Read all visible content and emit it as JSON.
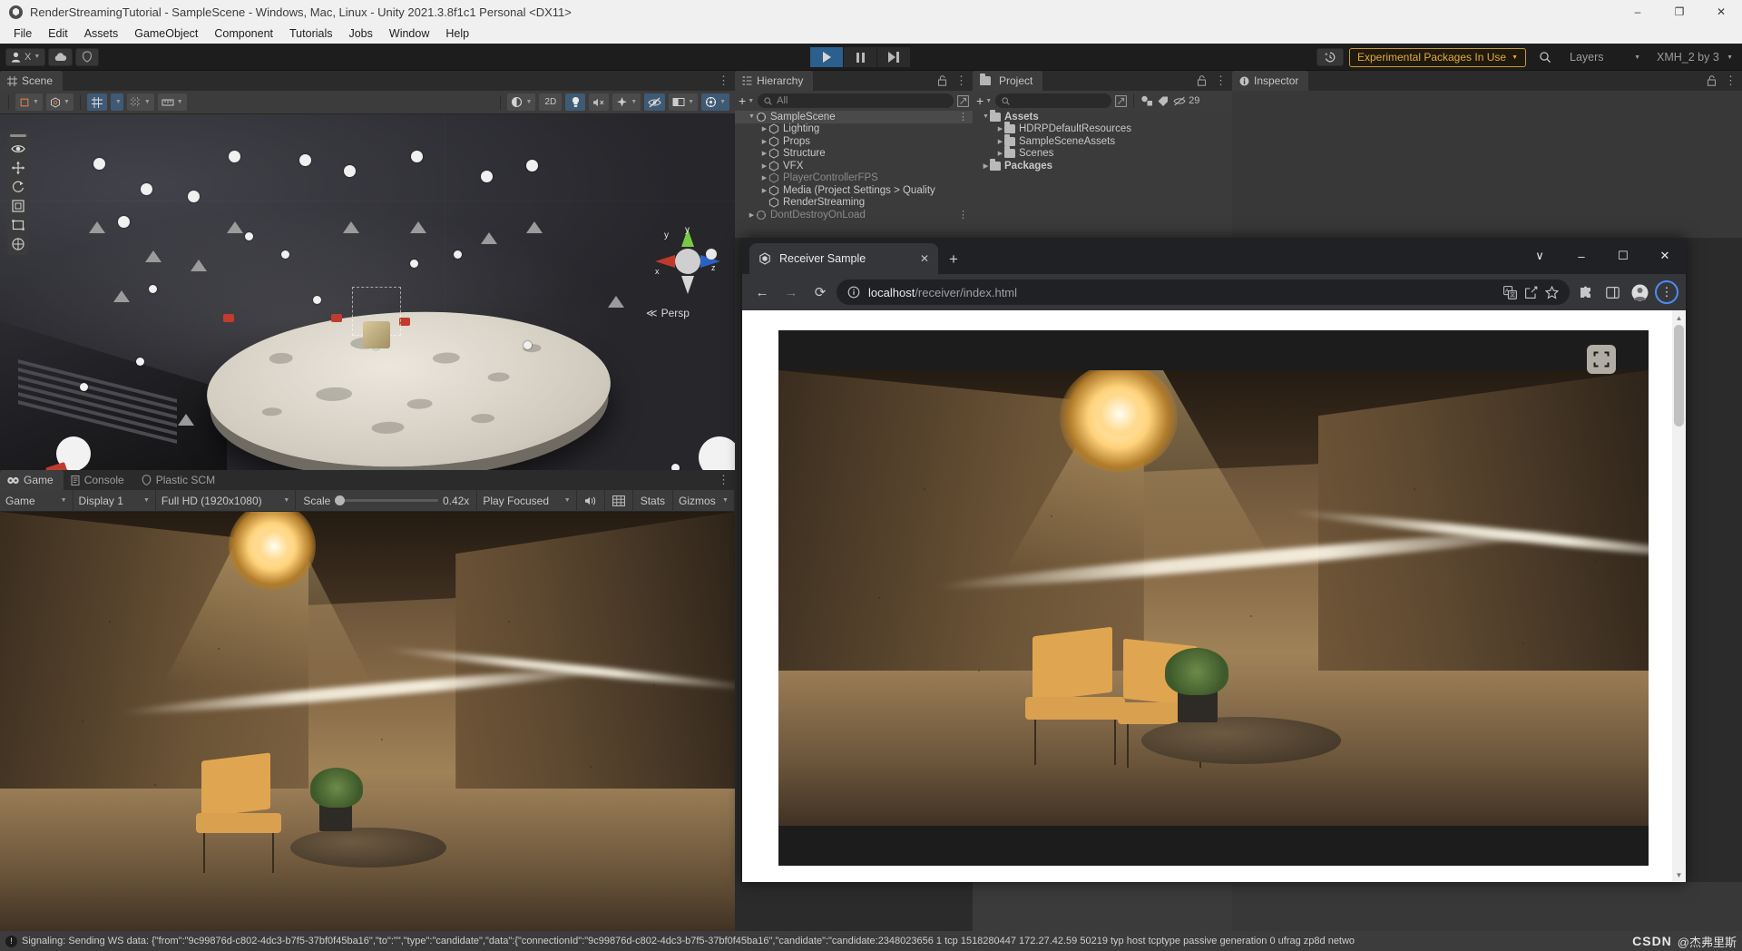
{
  "window": {
    "title": "RenderStreamingTutorial - SampleScene - Windows, Mac, Linux - Unity 2021.3.8f1c1 Personal <DX11>",
    "minimize": "–",
    "maximize": "❐",
    "close": "✕"
  },
  "menu": [
    "File",
    "Edit",
    "Assets",
    "GameObject",
    "Component",
    "Tutorials",
    "Jobs",
    "Window",
    "Help"
  ],
  "toolbar": {
    "account_label": "X",
    "cloud_icon": "cloud-icon",
    "collab_icon": "plastic-scm-icon",
    "play": "▶",
    "pause": "⏸",
    "step": "⏭",
    "history_icon": "undo-history-icon",
    "experimental_badge": "Experimental Packages In Use",
    "search_icon": "search-icon",
    "layers": "Layers",
    "account": "XMH_2 by 3"
  },
  "scene": {
    "tab": "Scene",
    "toolbar_buttons": [
      "hand-tool",
      "move-tool",
      "grid-snap",
      "grid-visibility",
      "ruler-tool"
    ],
    "right_buttons": [
      "shading-mode",
      "2D",
      "lighting-toggle",
      "audio-toggle",
      "fx-toggle",
      "hidden-objects",
      "camera-preview",
      "gizmos-toggle"
    ],
    "twod_label": "2D",
    "gizmo": {
      "x": "x",
      "y": "y",
      "z": "z",
      "projection": "Persp"
    }
  },
  "game": {
    "tabs": [
      {
        "label": "Game",
        "active": true,
        "icon": "game-icon"
      },
      {
        "label": "Console",
        "active": false,
        "icon": "console-icon"
      },
      {
        "label": "Plastic SCM",
        "active": false,
        "icon": "plastic-icon"
      }
    ],
    "target_display_dropdown": "Game",
    "display": "Display 1",
    "resolution": "Full HD (1920x1080)",
    "scale_label": "Scale",
    "scale_value": "0.42x",
    "play_mode": "Play Focused",
    "mute_icon": "audio-icon",
    "stats_icon": "stats-grid-icon",
    "stats": "Stats",
    "gizmos": "Gizmos"
  },
  "hierarchy": {
    "tab": "Hierarchy",
    "lock_icon": "lock-icon",
    "menu_icon": "kebab-menu-icon",
    "add_label": "+",
    "search_placeholder": "All",
    "items": [
      {
        "label": "SampleScene",
        "depth": 0,
        "expanded": true,
        "icon": "scene-icon",
        "selected": true,
        "kebab": true
      },
      {
        "label": "Lighting",
        "depth": 1,
        "expanded": false,
        "icon": "gameobject-icon"
      },
      {
        "label": "Props",
        "depth": 1,
        "expanded": false,
        "icon": "gameobject-icon"
      },
      {
        "label": "Structure",
        "depth": 1,
        "expanded": false,
        "icon": "gameobject-icon"
      },
      {
        "label": "VFX",
        "depth": 1,
        "expanded": false,
        "icon": "gameobject-icon"
      },
      {
        "label": "PlayerControllerFPS",
        "depth": 1,
        "expanded": false,
        "icon": "gameobject-icon",
        "dim": true
      },
      {
        "label": "Media (Project Settings > Quality",
        "depth": 1,
        "expanded": false,
        "icon": "gameobject-icon"
      },
      {
        "label": "RenderStreaming",
        "depth": 1,
        "expanded": null,
        "icon": "gameobject-icon"
      },
      {
        "label": "DontDestroyOnLoad",
        "depth": 0,
        "expanded": false,
        "icon": "scene-icon",
        "dim": true,
        "kebab": true
      }
    ]
  },
  "project": {
    "tab": "Project",
    "lock_icon": "lock-icon",
    "menu_icon": "kebab-menu-icon",
    "add_label": "+",
    "search_placeholder": "",
    "filter_icons": [
      "type-filter-icon",
      "label-filter-icon"
    ],
    "hidden_count": "29",
    "hidden_icon": "hidden-eye-icon",
    "items": [
      {
        "label": "Assets",
        "depth": 0,
        "expanded": true,
        "bold": true
      },
      {
        "label": "HDRPDefaultResources",
        "depth": 1,
        "expanded": false
      },
      {
        "label": "SampleSceneAssets",
        "depth": 1,
        "expanded": false
      },
      {
        "label": "Scenes",
        "depth": 1,
        "expanded": false
      },
      {
        "label": "Packages",
        "depth": 0,
        "expanded": false,
        "bold": true
      }
    ]
  },
  "inspector": {
    "tab": "Inspector",
    "lock_icon": "lock-icon",
    "menu_icon": "kebab-menu-icon"
  },
  "browser": {
    "tab_title": "Receiver Sample",
    "tab_close": "✕",
    "new_tab": "+",
    "window_controls": {
      "search_tabs": "∨",
      "minimize": "–",
      "maximize": "☐",
      "close": "✕"
    },
    "nav": {
      "back": "←",
      "forward": "→",
      "reload": "⟳"
    },
    "site_info_icon": "info-circle-icon",
    "url_host": "localhost",
    "url_path": "/receiver/index.html",
    "toolbar_icons": [
      "translate-icon",
      "share-icon",
      "bookmark-star-icon",
      "extensions-puzzle-icon",
      "side-panel-icon",
      "profile-avatar-icon"
    ],
    "menu_icon": "three-dot-menu-icon",
    "video_fullscreen_icon": "fullscreen-icon",
    "scrollbar_up": "▲",
    "scrollbar_down": "▼"
  },
  "statusbar": {
    "icon": "error-info-icon",
    "message": "Signaling: Sending WS data: {\"from\":\"9c99876d-c802-4dc3-b7f5-37bf0f45ba16\",\"to\":\"\",\"type\":\"candidate\",\"data\":{\"connectionId\":\"9c99876d-c802-4dc3-b7f5-37bf0f45ba16\",\"candidate\":\"candidate:2348023656 1 tcp 1518280447 172.27.42.59 50219 typ host tcptype passive generation 0 ufrag zp8d netwo"
  },
  "watermark": {
    "brand": "CSDN",
    "nickname": "@杰弗里斯"
  },
  "colors": {
    "unity_bg": "#383838",
    "panel_header": "#2b2b2b",
    "accent_blue": "#2b5f8d",
    "experimental": "#e0a93c",
    "chrome_dark": "#202124",
    "chrome_toolbar": "#35363a"
  }
}
